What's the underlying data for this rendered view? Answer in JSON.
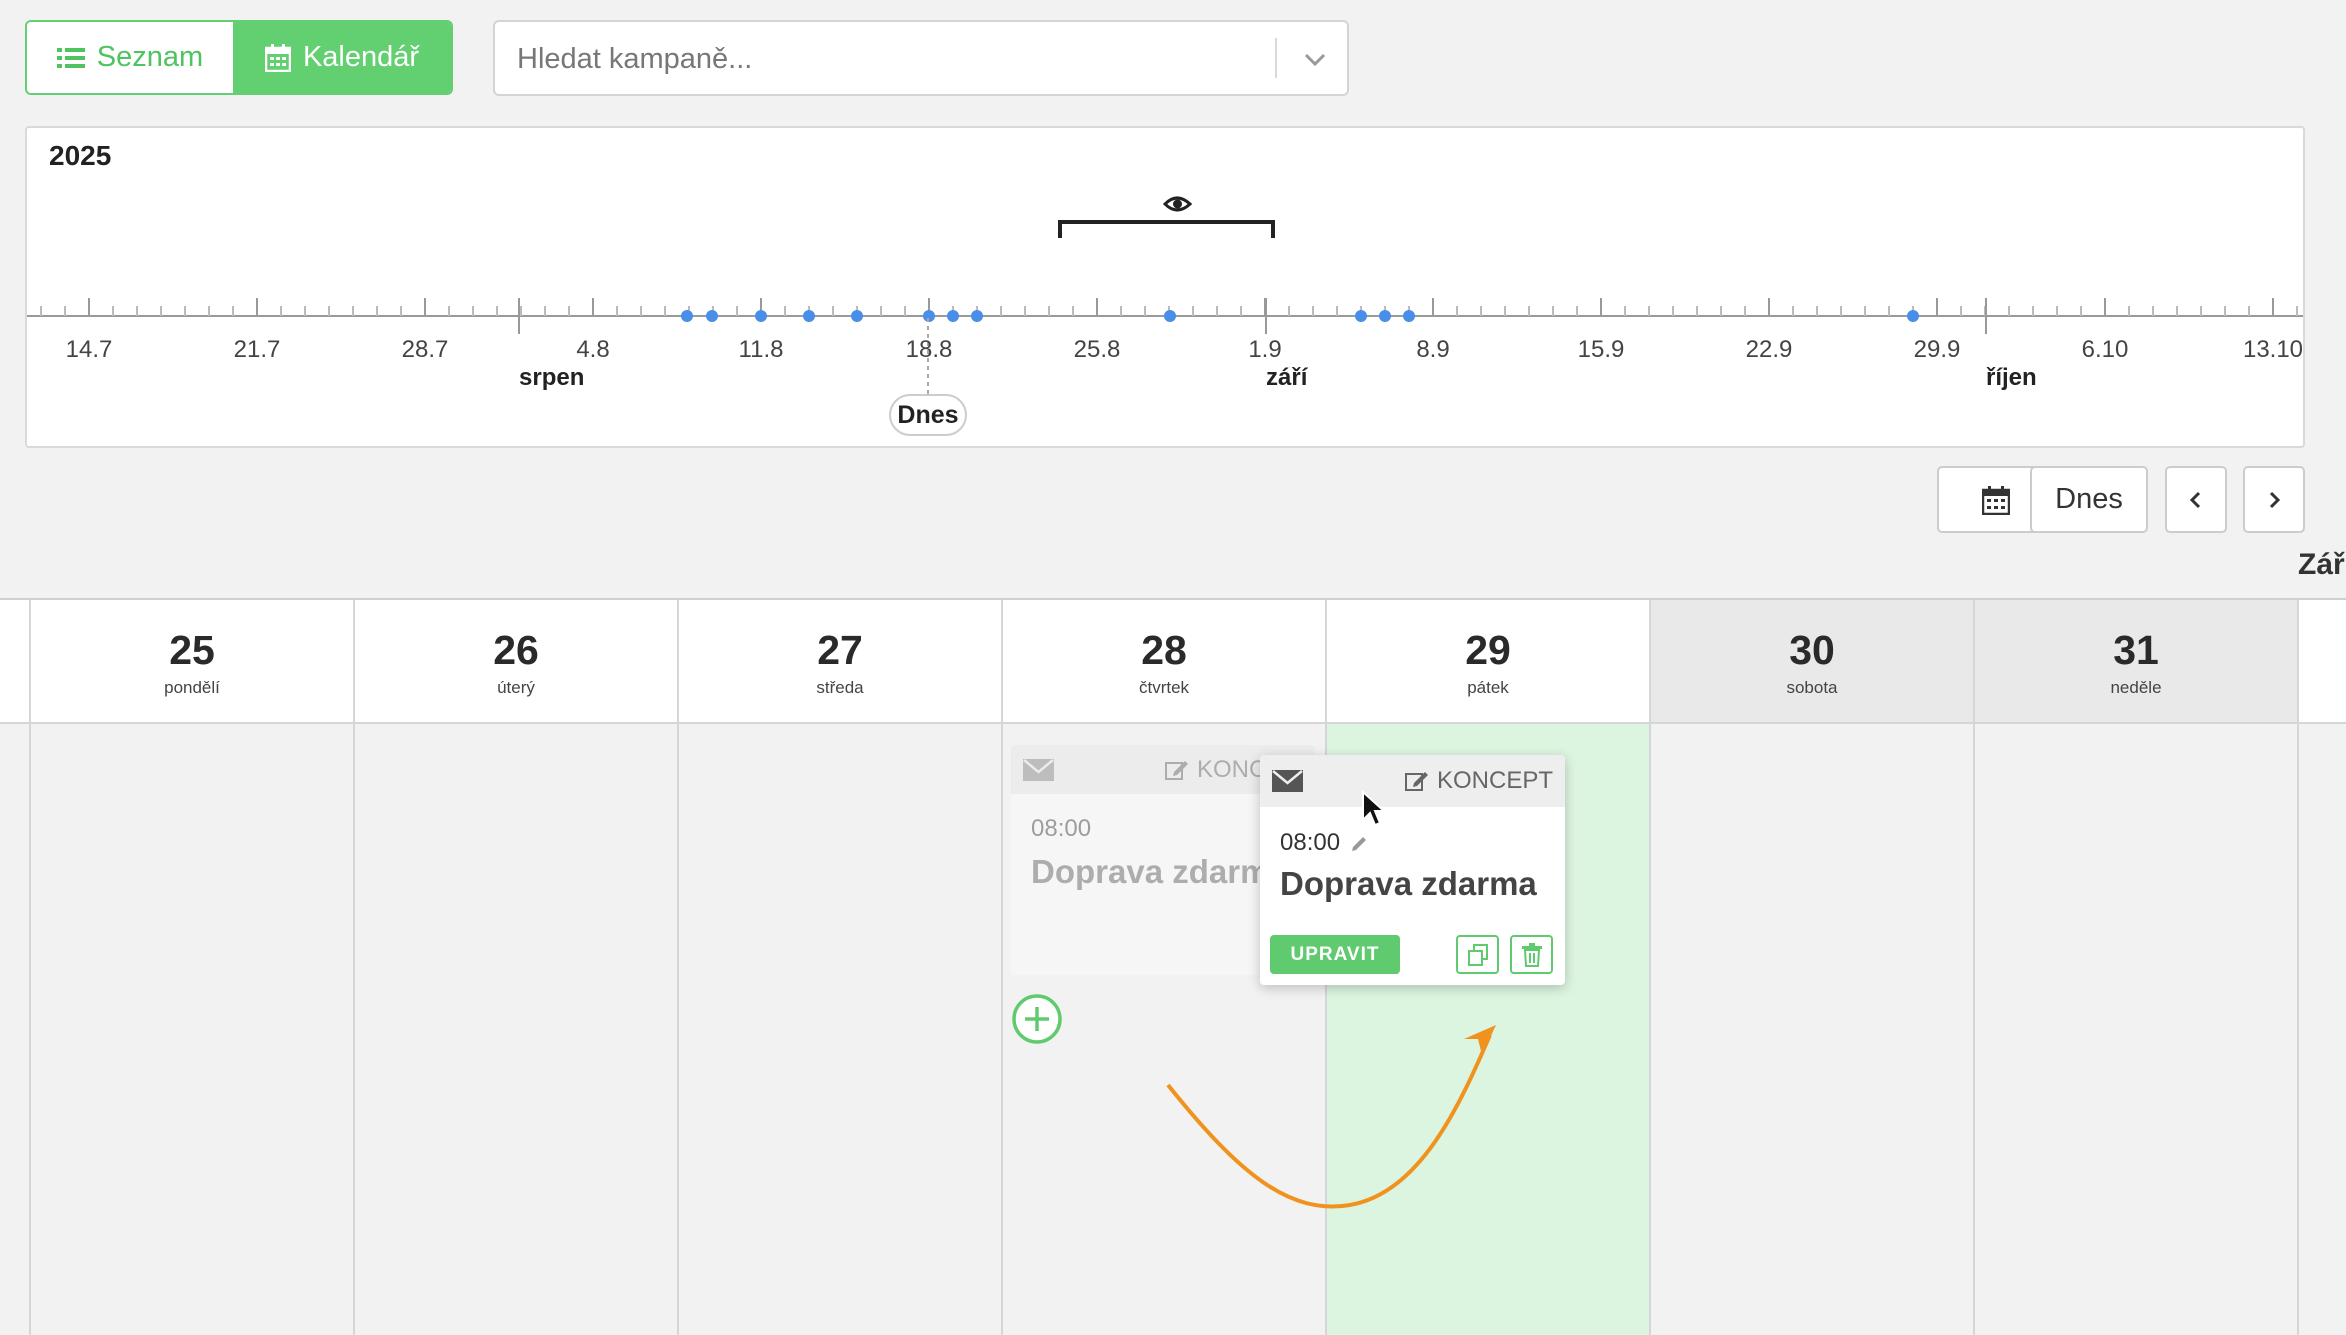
{
  "view_toggle": {
    "list_label": "Seznam",
    "calendar_label": "Kalendář",
    "active": "calendar"
  },
  "search": {
    "placeholder": "Hledat kampaně..."
  },
  "timeline": {
    "year": "2025",
    "ticks": [
      {
        "label": "14.7"
      },
      {
        "label": "21.7"
      },
      {
        "label": "28.7"
      },
      {
        "label": "4.8"
      },
      {
        "label": "11.8"
      },
      {
        "label": "18.8"
      },
      {
        "label": "25.8"
      },
      {
        "label": "1.9"
      },
      {
        "label": "8.9"
      },
      {
        "label": "15.9"
      },
      {
        "label": "22.9"
      },
      {
        "label": "29.9"
      },
      {
        "label": "6.10"
      },
      {
        "label": "13.10"
      }
    ],
    "months": [
      "srpen",
      "září",
      "říjen"
    ],
    "today_label": "Dnes",
    "view_window_icon": "eye-icon"
  },
  "nav": {
    "calendar_icon": "calendar-icon",
    "today_label": "Dnes",
    "prev_icon": "chevron-left-icon",
    "next_icon": "chevron-right-icon"
  },
  "month_label": "Zář",
  "week": [
    {
      "day": "25",
      "name": "pondělí",
      "weekend": false
    },
    {
      "day": "26",
      "name": "úterý",
      "weekend": false
    },
    {
      "day": "27",
      "name": "středa",
      "weekend": false
    },
    {
      "day": "28",
      "name": "čtvrtek",
      "weekend": false
    },
    {
      "day": "29",
      "name": "pátek",
      "weekend": false
    },
    {
      "day": "30",
      "name": "sobota",
      "weekend": true
    },
    {
      "day": "31",
      "name": "neděle",
      "weekend": true
    }
  ],
  "ghost_card": {
    "status": "KONC",
    "time": "08:00",
    "name": "Doprava zdarma"
  },
  "campaign_card": {
    "status": "KONCEPT",
    "time": "08:00",
    "name": "Doprava zdarma",
    "edit_label": "UPRAVIT"
  },
  "colors": {
    "accent": "#62cf71",
    "dot": "#4a8fe7",
    "arrow": "#f0921e",
    "highlight": "#dcf5e0"
  }
}
